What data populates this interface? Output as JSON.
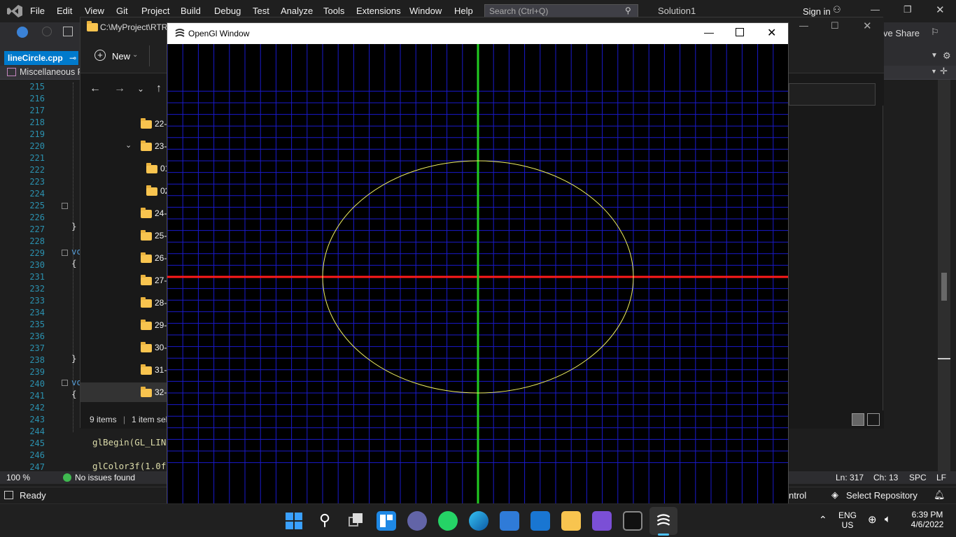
{
  "vs": {
    "menu": [
      "File",
      "Edit",
      "View",
      "Git",
      "Project",
      "Build",
      "Debug",
      "Test",
      "Analyze",
      "Tools",
      "Extensions",
      "Window",
      "Help"
    ],
    "search_placeholder": "Search (Ctrl+Q)",
    "solution_name": "Solution1",
    "sign_in": "Sign in",
    "live_share": "ve Share",
    "file_tab": "lineCircle.cpp",
    "nav_project": "Miscellaneous Fi",
    "line_numbers": [
      "215",
      "216",
      "217",
      "218",
      "219",
      "220",
      "221",
      "222",
      "223",
      "224",
      "225",
      "226",
      "227",
      "228",
      "229",
      "230",
      "231",
      "232",
      "233",
      "234",
      "235",
      "236",
      "237",
      "238",
      "239",
      "240",
      "241",
      "242",
      "243",
      "244",
      "245",
      "246",
      "247"
    ],
    "code_fragments": {
      "line229": "vo",
      "line240": "vo",
      "line245": "glBegin(GL_LIN",
      "line247": "glColor3f(1.0f"
    },
    "zoom": "100 %",
    "issues": "No issues found",
    "position": {
      "line": "Ln: 317",
      "col": "Ch: 13",
      "spc": "SPC",
      "eol": "LF"
    },
    "status_ready": "Ready",
    "status_control": "ntrol",
    "select_repo": "Select Repository"
  },
  "explorer": {
    "path": "C:\\MyProject\\RTR\\",
    "new_button": "New",
    "folders": [
      {
        "label": "22-",
        "indent": 0
      },
      {
        "label": "23-",
        "indent": 0,
        "expanded": true
      },
      {
        "label": "01",
        "indent": 1
      },
      {
        "label": "02",
        "indent": 1
      },
      {
        "label": "24-",
        "indent": 0
      },
      {
        "label": "25-",
        "indent": 0
      },
      {
        "label": "26-",
        "indent": 0
      },
      {
        "label": "27-",
        "indent": 0
      },
      {
        "label": "28-",
        "indent": 0
      },
      {
        "label": "29-",
        "indent": 0
      },
      {
        "label": "30-",
        "indent": 0
      },
      {
        "label": "31-",
        "indent": 0
      },
      {
        "label": "32-",
        "indent": 0,
        "selected": true
      }
    ],
    "items_count": "9 items",
    "selection": "1 item sel"
  },
  "gl_window": {
    "title": "OpenGl Window",
    "colors": {
      "background": "#000000",
      "grid": "#1a1acc",
      "x_axis": "#ff1a1a",
      "y_axis": "#22cc22",
      "ellipse": "#f0f060"
    }
  },
  "taskbar": {
    "apps": [
      "start-icon",
      "search-icon",
      "task-view-icon",
      "widgets-icon",
      "teams-chat-icon",
      "whatsapp-icon",
      "edge-icon",
      "store-icon",
      "mail-icon",
      "file-explorer-icon",
      "visual-studio-icon",
      "terminal-icon",
      "opengl-app-icon"
    ],
    "lang_line1": "ENG",
    "lang_line2": "US",
    "time": "6:39 PM",
    "date": "4/6/2022"
  }
}
